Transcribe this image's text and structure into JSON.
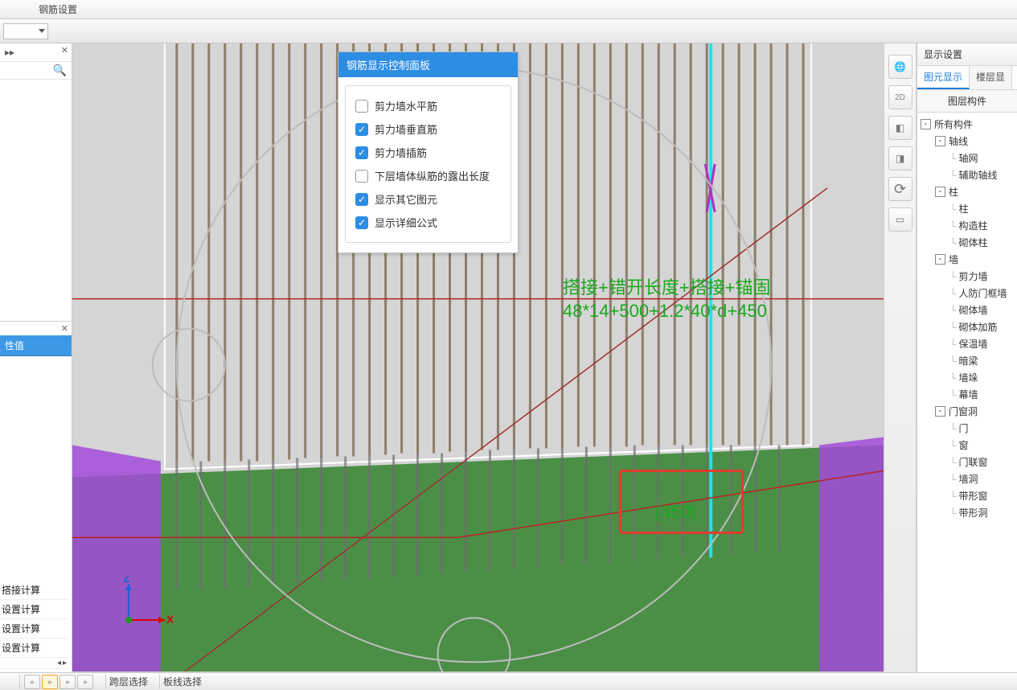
{
  "title_bar": {
    "label": "钢筋设置"
  },
  "ctrl_panel": {
    "title": "钢筋显示控制面板",
    "items": [
      {
        "label": "剪力墙水平筋",
        "checked": false
      },
      {
        "label": "剪力墙垂直筋",
        "checked": true
      },
      {
        "label": "剪力墙插筋",
        "checked": true
      },
      {
        "label": "下层墙体纵筋的露出长度",
        "checked": false
      },
      {
        "label": "显示其它图元",
        "checked": true
      },
      {
        "label": "显示详细公式",
        "checked": true
      }
    ]
  },
  "annotation": {
    "line1": "搭接+错开长度+搭接+锚固",
    "line2": "48*14+500+1.2*40*d+450"
  },
  "red_box": {
    "label": "(450)"
  },
  "left": {
    "prop_header": "性值",
    "bottom_items": [
      "搭接计算",
      "设置计算",
      "设置计算",
      "设置计算"
    ]
  },
  "right": {
    "header": "显示设置",
    "tabs": {
      "active": "图元显示",
      "inactive": "楼层显"
    },
    "layer_header": "图层构件",
    "tree": [
      {
        "d": 0,
        "t": "-",
        "label": "所有构件"
      },
      {
        "d": 1,
        "t": "-",
        "label": "轴线"
      },
      {
        "d": 2,
        "t": "",
        "label": "轴网"
      },
      {
        "d": 2,
        "t": "",
        "label": "辅助轴线"
      },
      {
        "d": 1,
        "t": "-",
        "label": "柱"
      },
      {
        "d": 2,
        "t": "",
        "label": "柱"
      },
      {
        "d": 2,
        "t": "",
        "label": "构造柱"
      },
      {
        "d": 2,
        "t": "",
        "label": "砌体柱"
      },
      {
        "d": 1,
        "t": "-",
        "label": "墙"
      },
      {
        "d": 2,
        "t": "",
        "label": "剪力墙"
      },
      {
        "d": 2,
        "t": "",
        "label": "人防门框墙"
      },
      {
        "d": 2,
        "t": "",
        "label": "砌体墙"
      },
      {
        "d": 2,
        "t": "",
        "label": "砌体加筋"
      },
      {
        "d": 2,
        "t": "",
        "label": "保温墙"
      },
      {
        "d": 2,
        "t": "",
        "label": "暗梁"
      },
      {
        "d": 2,
        "t": "",
        "label": "墙垛"
      },
      {
        "d": 2,
        "t": "",
        "label": "幕墙"
      },
      {
        "d": 1,
        "t": "-",
        "label": "门窗洞"
      },
      {
        "d": 2,
        "t": "",
        "label": "门"
      },
      {
        "d": 2,
        "t": "",
        "label": "窗"
      },
      {
        "d": 2,
        "t": "",
        "label": "门联窗"
      },
      {
        "d": 2,
        "t": "",
        "label": "墙洞"
      },
      {
        "d": 2,
        "t": "",
        "label": "带形窗"
      },
      {
        "d": 2,
        "t": "",
        "label": "带形洞"
      }
    ]
  },
  "status": {
    "coord": "  ",
    "items": [
      "跨层选择",
      "板线选择",
      "",
      ""
    ]
  },
  "axis": {
    "x": "X",
    "z": "Z"
  },
  "palette_2d": "2D"
}
